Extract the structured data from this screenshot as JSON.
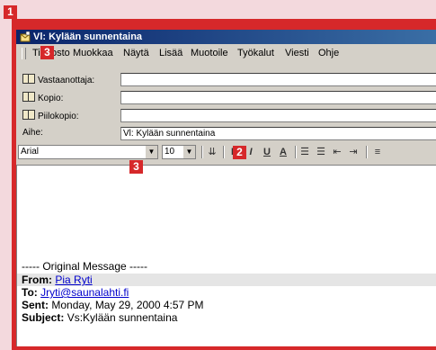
{
  "badges": [
    "1",
    "2",
    "3",
    "3"
  ],
  "window": {
    "title": "Vl: Kylään sunnentaina"
  },
  "menu": [
    {
      "label": "Tiedosto"
    },
    {
      "label": "Muokkaa"
    },
    {
      "label": "Näytä"
    },
    {
      "label": "Lisää"
    },
    {
      "label": "Muotoile"
    },
    {
      "label": "Työkalut"
    },
    {
      "label": "Viesti"
    },
    {
      "label": "Ohje"
    }
  ],
  "header": {
    "to_label": "Vastaanottaja:",
    "to_value": "",
    "cc_label": "Kopio:",
    "cc_value": "",
    "bcc_label": "Piilokopio:",
    "bcc_value": "",
    "subject_label": "Aihe:",
    "subject_value": "Vl: Kylään sunnentaina"
  },
  "format": {
    "font": "Arial",
    "size": "10"
  },
  "message": {
    "original_line": "----- Original Message -----",
    "from_label": "From:",
    "from_value": "Pia Ryti",
    "to_label": "To:",
    "to_value": "Jryti@saunalahti.fi",
    "sent_label": "Sent:",
    "sent_value": "Monday, May 29, 2000 4:57 PM",
    "subject_label": "Subject:",
    "subject_value": "Vs:Kylään sunnentaina"
  },
  "colors": {
    "badge": "#d6282a",
    "titlebar": "#0a246a",
    "link": "#0000cc"
  }
}
